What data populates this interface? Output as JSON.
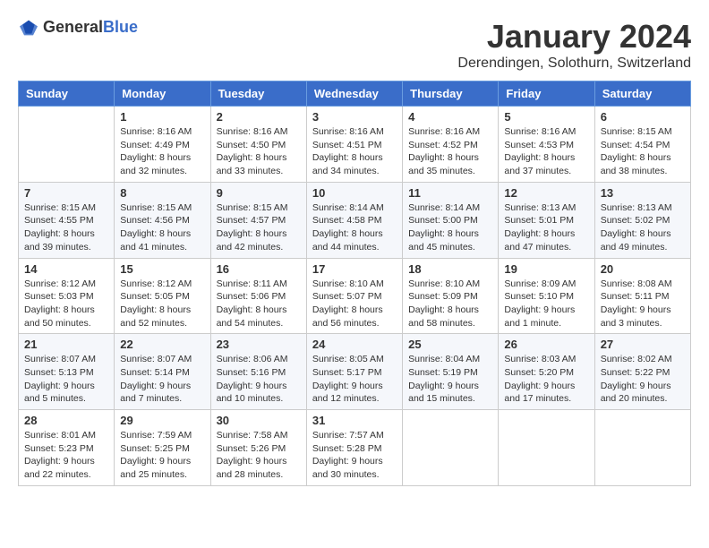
{
  "header": {
    "logo_general": "General",
    "logo_blue": "Blue",
    "month_title": "January 2024",
    "location": "Derendingen, Solothurn, Switzerland"
  },
  "days_of_week": [
    "Sunday",
    "Monday",
    "Tuesday",
    "Wednesday",
    "Thursday",
    "Friday",
    "Saturday"
  ],
  "weeks": [
    [
      {
        "day": "",
        "info": ""
      },
      {
        "day": "1",
        "info": "Sunrise: 8:16 AM\nSunset: 4:49 PM\nDaylight: 8 hours\nand 32 minutes."
      },
      {
        "day": "2",
        "info": "Sunrise: 8:16 AM\nSunset: 4:50 PM\nDaylight: 8 hours\nand 33 minutes."
      },
      {
        "day": "3",
        "info": "Sunrise: 8:16 AM\nSunset: 4:51 PM\nDaylight: 8 hours\nand 34 minutes."
      },
      {
        "day": "4",
        "info": "Sunrise: 8:16 AM\nSunset: 4:52 PM\nDaylight: 8 hours\nand 35 minutes."
      },
      {
        "day": "5",
        "info": "Sunrise: 8:16 AM\nSunset: 4:53 PM\nDaylight: 8 hours\nand 37 minutes."
      },
      {
        "day": "6",
        "info": "Sunrise: 8:15 AM\nSunset: 4:54 PM\nDaylight: 8 hours\nand 38 minutes."
      }
    ],
    [
      {
        "day": "7",
        "info": "Sunrise: 8:15 AM\nSunset: 4:55 PM\nDaylight: 8 hours\nand 39 minutes."
      },
      {
        "day": "8",
        "info": "Sunrise: 8:15 AM\nSunset: 4:56 PM\nDaylight: 8 hours\nand 41 minutes."
      },
      {
        "day": "9",
        "info": "Sunrise: 8:15 AM\nSunset: 4:57 PM\nDaylight: 8 hours\nand 42 minutes."
      },
      {
        "day": "10",
        "info": "Sunrise: 8:14 AM\nSunset: 4:58 PM\nDaylight: 8 hours\nand 44 minutes."
      },
      {
        "day": "11",
        "info": "Sunrise: 8:14 AM\nSunset: 5:00 PM\nDaylight: 8 hours\nand 45 minutes."
      },
      {
        "day": "12",
        "info": "Sunrise: 8:13 AM\nSunset: 5:01 PM\nDaylight: 8 hours\nand 47 minutes."
      },
      {
        "day": "13",
        "info": "Sunrise: 8:13 AM\nSunset: 5:02 PM\nDaylight: 8 hours\nand 49 minutes."
      }
    ],
    [
      {
        "day": "14",
        "info": "Sunrise: 8:12 AM\nSunset: 5:03 PM\nDaylight: 8 hours\nand 50 minutes."
      },
      {
        "day": "15",
        "info": "Sunrise: 8:12 AM\nSunset: 5:05 PM\nDaylight: 8 hours\nand 52 minutes."
      },
      {
        "day": "16",
        "info": "Sunrise: 8:11 AM\nSunset: 5:06 PM\nDaylight: 8 hours\nand 54 minutes."
      },
      {
        "day": "17",
        "info": "Sunrise: 8:10 AM\nSunset: 5:07 PM\nDaylight: 8 hours\nand 56 minutes."
      },
      {
        "day": "18",
        "info": "Sunrise: 8:10 AM\nSunset: 5:09 PM\nDaylight: 8 hours\nand 58 minutes."
      },
      {
        "day": "19",
        "info": "Sunrise: 8:09 AM\nSunset: 5:10 PM\nDaylight: 9 hours\nand 1 minute."
      },
      {
        "day": "20",
        "info": "Sunrise: 8:08 AM\nSunset: 5:11 PM\nDaylight: 9 hours\nand 3 minutes."
      }
    ],
    [
      {
        "day": "21",
        "info": "Sunrise: 8:07 AM\nSunset: 5:13 PM\nDaylight: 9 hours\nand 5 minutes."
      },
      {
        "day": "22",
        "info": "Sunrise: 8:07 AM\nSunset: 5:14 PM\nDaylight: 9 hours\nand 7 minutes."
      },
      {
        "day": "23",
        "info": "Sunrise: 8:06 AM\nSunset: 5:16 PM\nDaylight: 9 hours\nand 10 minutes."
      },
      {
        "day": "24",
        "info": "Sunrise: 8:05 AM\nSunset: 5:17 PM\nDaylight: 9 hours\nand 12 minutes."
      },
      {
        "day": "25",
        "info": "Sunrise: 8:04 AM\nSunset: 5:19 PM\nDaylight: 9 hours\nand 15 minutes."
      },
      {
        "day": "26",
        "info": "Sunrise: 8:03 AM\nSunset: 5:20 PM\nDaylight: 9 hours\nand 17 minutes."
      },
      {
        "day": "27",
        "info": "Sunrise: 8:02 AM\nSunset: 5:22 PM\nDaylight: 9 hours\nand 20 minutes."
      }
    ],
    [
      {
        "day": "28",
        "info": "Sunrise: 8:01 AM\nSunset: 5:23 PM\nDaylight: 9 hours\nand 22 minutes."
      },
      {
        "day": "29",
        "info": "Sunrise: 7:59 AM\nSunset: 5:25 PM\nDaylight: 9 hours\nand 25 minutes."
      },
      {
        "day": "30",
        "info": "Sunrise: 7:58 AM\nSunset: 5:26 PM\nDaylight: 9 hours\nand 28 minutes."
      },
      {
        "day": "31",
        "info": "Sunrise: 7:57 AM\nSunset: 5:28 PM\nDaylight: 9 hours\nand 30 minutes."
      },
      {
        "day": "",
        "info": ""
      },
      {
        "day": "",
        "info": ""
      },
      {
        "day": "",
        "info": ""
      }
    ]
  ]
}
